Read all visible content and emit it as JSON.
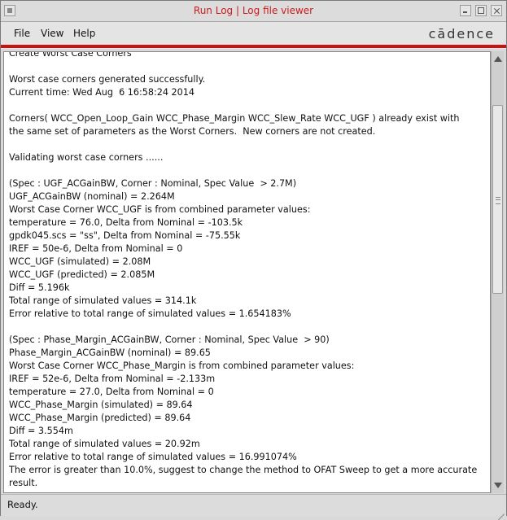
{
  "window": {
    "title": "Run Log | Log file viewer"
  },
  "menu": {
    "file": "File",
    "view": "View",
    "help": "Help"
  },
  "brand": "cādence",
  "log_lines": [
    "Create Worst Case Corners",
    "",
    "Worst case corners generated successfully.",
    "Current time: Wed Aug  6 16:58:24 2014",
    "",
    "Corners( WCC_Open_Loop_Gain WCC_Phase_Margin WCC_Slew_Rate WCC_UGF ) already exist with",
    "the same set of parameters as the Worst Corners.  New corners are not created.",
    "",
    "Validating worst case corners ......",
    "",
    "(Spec : UGF_ACGainBW, Corner : Nominal, Spec Value  > 2.7M)",
    "UGF_ACGainBW (nominal) = 2.264M",
    "Worst Case Corner WCC_UGF is from combined parameter values:",
    "temperature = 76.0, Delta from Nominal = -103.5k",
    "gpdk045.scs = \"ss\", Delta from Nominal = -75.55k",
    "IREF = 50e-6, Delta from Nominal = 0",
    "WCC_UGF (simulated) = 2.08M",
    "WCC_UGF (predicted) = 2.085M",
    "Diff = 5.196k",
    "Total range of simulated values = 314.1k",
    "Error relative to total range of simulated values = 1.654183%",
    "",
    "(Spec : Phase_Margin_ACGainBW, Corner : Nominal, Spec Value  > 90)",
    "Phase_Margin_ACGainBW (nominal) = 89.65",
    "Worst Case Corner WCC_Phase_Margin is from combined parameter values:",
    "IREF = 52e-6, Delta from Nominal = -2.133m",
    "temperature = 27.0, Delta from Nominal = 0",
    "WCC_Phase_Margin (simulated) = 89.64",
    "WCC_Phase_Margin (predicted) = 89.64",
    "Diff = 3.554m",
    "Total range of simulated values = 20.92m",
    "Error relative to total range of simulated values = 16.991074%",
    "The error is greater than 10.0%, suggest to change the method to OFAT Sweep to get a more accurate",
    "result."
  ],
  "status": "Ready.",
  "colors": {
    "title_text": "#cc1a1a",
    "accent_line": "#cc1111"
  }
}
